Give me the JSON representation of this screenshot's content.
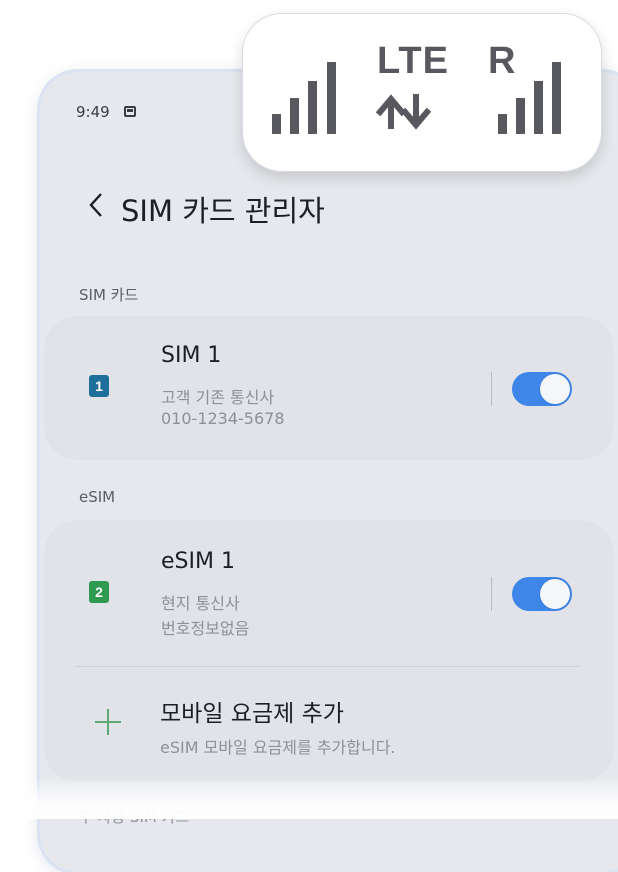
{
  "status_bar": {
    "time": "9:49"
  },
  "signal_callout": {
    "network": "LTE",
    "roaming": "R"
  },
  "header": {
    "title": "SIM 카드 관리자"
  },
  "sections": {
    "sim": {
      "label": "SIM 카드"
    },
    "esim": {
      "label": "eSIM"
    },
    "primary": {
      "label": "주 사용 SIM 카드"
    }
  },
  "sim1": {
    "badge": "1",
    "badge_color": "#1f6f9c",
    "name": "SIM 1",
    "carrier": "고객 기존 통신사",
    "number": "010-1234-5678",
    "enabled": true
  },
  "esim1": {
    "badge": "2",
    "badge_color": "#2e9a4f",
    "name": "eSIM 1",
    "carrier": "현지 통신사",
    "number": "번호정보없음",
    "enabled": true
  },
  "add_plan": {
    "title": "모바일 요금제 추가",
    "subtitle": "eSIM 모바일 요금제를 추가합니다."
  },
  "colors": {
    "toggle_on": "#3e86e8",
    "plus_icon": "#5faa74"
  }
}
